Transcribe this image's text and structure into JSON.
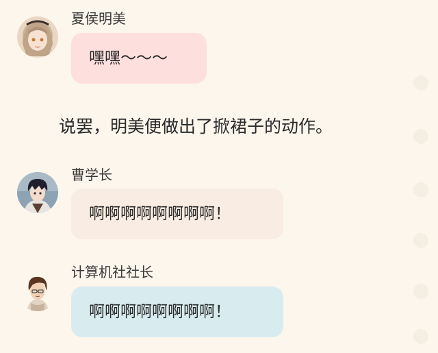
{
  "messages": [
    {
      "speaker": "夏侯明美",
      "text": "嘿嘿～～～",
      "bubble_color": "#fde0de"
    },
    {
      "speaker": "曹学长",
      "text": "啊啊啊啊啊啊啊啊！",
      "bubble_color": "#f9ece2"
    },
    {
      "speaker": "计算机社社长",
      "text": "啊啊啊啊啊啊啊啊！",
      "bubble_color": "#d8ecf0"
    }
  ],
  "narration": "说罢，明美便做出了掀裙子的动作。",
  "colors": {
    "background": "#fdf6ec"
  }
}
